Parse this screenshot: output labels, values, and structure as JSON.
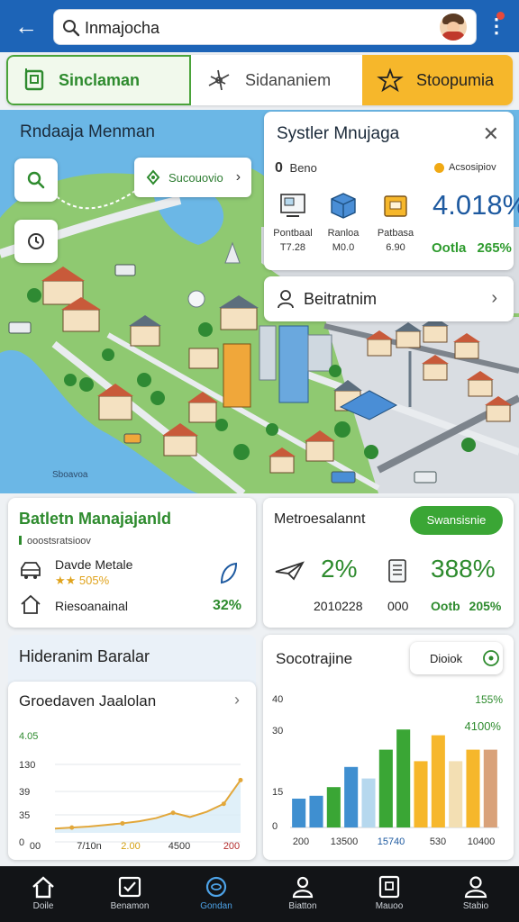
{
  "header": {
    "search_value": "Inmajocha",
    "colors": {
      "bar": "#1d64b7",
      "accent_green": "#3aa635",
      "accent_yellow": "#f6b72b"
    }
  },
  "tabs": [
    {
      "label": "Sinclaman",
      "icon": "building-icon",
      "state": "active"
    },
    {
      "label": "Sidananiem",
      "icon": "compass-icon"
    },
    {
      "label": "Stoopumia",
      "icon": "star-icon",
      "state": "highlighted"
    }
  ],
  "map": {
    "title": "Rndaaja Menman",
    "chip_label": "Sucouovio",
    "watermark": "Sboavoa"
  },
  "stats_panel": {
    "title": "Systler Mnujaga",
    "count": "0",
    "count_label": "Beno",
    "status_label": "Acsosipiov",
    "categories": [
      {
        "label": "Pontbaal",
        "value": "T7.28",
        "icon": "monitor-icon"
      },
      {
        "label": "Ranloa",
        "value": "M0.0",
        "icon": "cube-icon"
      },
      {
        "label": "Patbasa",
        "value": "6.90",
        "icon": "box-icon"
      }
    ],
    "big_value": "4.018%",
    "footer_label": "Ootla",
    "footer_value": "265%"
  },
  "result_row": {
    "label": "Beitratnim"
  },
  "card_manage": {
    "title": "Batletn Manajajanld",
    "subtitle": "ooostsratsioov",
    "row1_name": "Davde Metale",
    "row1_rating": "★★ 505%",
    "row2_name": "Riesoanainal",
    "row2_value": "32%"
  },
  "card_metrics": {
    "title": "Metroesalannt",
    "button_label": "Swansisnie",
    "value_1": "2%",
    "value_2": "388%",
    "sub_1": "2010228",
    "sub_2": "000",
    "sub_3_label": "Ootb",
    "sub_3_value": "205%"
  },
  "line_section": {
    "title": "Hideranim Baralar",
    "chart_title": "Groedaven Jaalolan"
  },
  "bar_section": {
    "title": "Socotrajine",
    "button_label": "Dioiok"
  },
  "chart_data": [
    {
      "type": "line",
      "title": "Groedaven Jaalolan",
      "top_label": "4.05",
      "y_ticks": [
        "130",
        "39",
        "35",
        "0"
      ],
      "x_ticks": [
        "00",
        "7/10n",
        "2.00",
        "4500",
        "200"
      ],
      "ylim": [
        0,
        150
      ],
      "x": [
        0,
        1,
        2,
        3,
        4,
        5,
        6,
        7,
        8,
        9,
        10,
        11
      ],
      "series": [
        {
          "values": [
            8,
            10,
            12,
            15,
            18,
            22,
            28,
            38,
            30,
            40,
            55,
            100
          ]
        }
      ]
    },
    {
      "type": "bar",
      "y_ticks": [
        "40",
        "30",
        "15",
        "0"
      ],
      "x_ticks": [
        "200",
        "13500",
        "15740",
        "530",
        "10400"
      ],
      "annotations": [
        "155%",
        "4100%"
      ],
      "ylim": [
        0,
        40
      ],
      "values": [
        10,
        11,
        14,
        21,
        17,
        27,
        34,
        23,
        32,
        23,
        27,
        27
      ],
      "colors": [
        "#3f8fd0",
        "#3f8fd0",
        "#3aa635",
        "#3f8fd0",
        "#b6d8ee",
        "#3aa635",
        "#3aa635",
        "#f6b72b",
        "#f6b72b",
        "#f3dfb3",
        "#f6b72b",
        "#d9a27a"
      ]
    }
  ],
  "nav": [
    {
      "label": "Doile",
      "icon": "home-icon"
    },
    {
      "label": "Benamon",
      "icon": "task-icon"
    },
    {
      "label": "Gondan",
      "icon": "globe-icon",
      "state": "active"
    },
    {
      "label": "Biatton",
      "icon": "person-icon"
    },
    {
      "label": "Mauoo",
      "icon": "tablet-icon"
    },
    {
      "label": "Stabio",
      "icon": "profile-icon"
    }
  ]
}
